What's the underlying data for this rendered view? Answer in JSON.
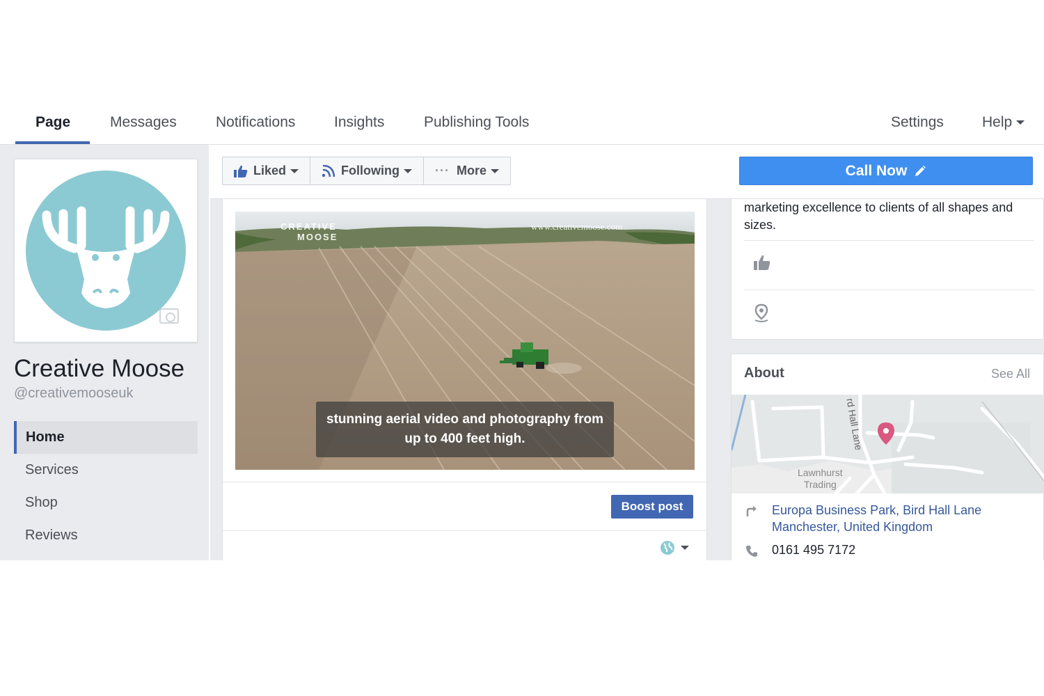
{
  "nav": {
    "tabs": [
      "Page",
      "Messages",
      "Notifications",
      "Insights",
      "Publishing Tools"
    ],
    "settings": "Settings",
    "help": "Help"
  },
  "page": {
    "name": "Creative Moose",
    "handle": "@creativemooseuk"
  },
  "sidebar": {
    "items": [
      {
        "label": "Home",
        "active": true
      },
      {
        "label": "Services"
      },
      {
        "label": "Shop"
      },
      {
        "label": "Reviews"
      }
    ]
  },
  "actions": {
    "liked": "Liked",
    "following": "Following",
    "more": "More",
    "call_now": "Call Now"
  },
  "post": {
    "watermark_left_line1": "CREATIVE",
    "watermark_left_line2": "MOOSE",
    "watermark_right": "www.creativemoose.com",
    "caption_line1": "stunning aerial video and photography from",
    "caption_line2": "up to 400 feet high.",
    "boost_label": "Boost post"
  },
  "right": {
    "description_line1": "marketing excellence to clients of all shapes and",
    "description_line2": "sizes.",
    "about_title": "About",
    "see_all": "See All",
    "map_label_road": "rd Hall Lane",
    "map_label_place1": "Lawnhurst",
    "map_label_place2": "Trading",
    "address_line1": "Europa Business Park, Bird Hall Lane",
    "address_line2": "Manchester, United Kingdom",
    "phone": "0161 495 7172"
  },
  "colors": {
    "brand_blue": "#4267b2",
    "call_now_blue": "#3f8ff0",
    "profile_teal": "#8ccad3",
    "map_pin": "#d9587f"
  }
}
